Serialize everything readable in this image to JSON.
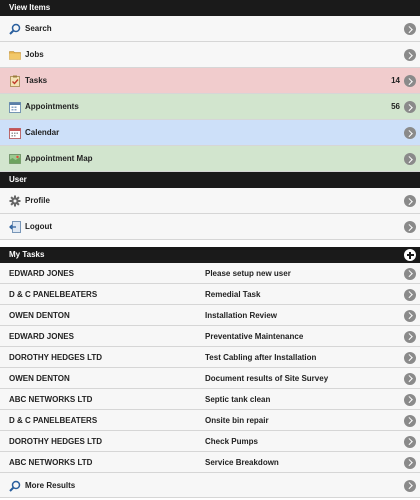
{
  "view_items": {
    "header": "View Items",
    "items": [
      {
        "label": "Search",
        "icon": "search-icon",
        "count": ""
      },
      {
        "label": "Jobs",
        "icon": "folder-icon",
        "count": ""
      },
      {
        "label": "Tasks",
        "icon": "tasks-icon",
        "count": "14"
      },
      {
        "label": "Appointments",
        "icon": "appointments-icon",
        "count": "56"
      },
      {
        "label": "Calendar",
        "icon": "calendar-icon",
        "count": ""
      },
      {
        "label": "Appointment Map",
        "icon": "map-icon",
        "count": ""
      }
    ]
  },
  "user": {
    "header": "User",
    "items": [
      {
        "label": "Profile",
        "icon": "gear-icon"
      },
      {
        "label": "Logout",
        "icon": "logout-icon"
      }
    ]
  },
  "my_tasks": {
    "header": "My Tasks",
    "rows": [
      {
        "client": "EDWARD JONES",
        "task": "Please setup new user"
      },
      {
        "client": "D & C PANELBEATERS",
        "task": "Remedial Task"
      },
      {
        "client": "OWEN DENTON",
        "task": "Installation Review"
      },
      {
        "client": "EDWARD JONES",
        "task": "Preventative Maintenance"
      },
      {
        "client": "DOROTHY HEDGES LTD",
        "task": "Test Cabling after Installation"
      },
      {
        "client": "OWEN DENTON",
        "task": "Document results of Site Survey"
      },
      {
        "client": "ABC NETWORKS LTD",
        "task": "Septic tank clean"
      },
      {
        "client": "D & C PANELBEATERS",
        "task": "Onsite bin repair"
      },
      {
        "client": "DOROTHY HEDGES LTD",
        "task": "Check Pumps"
      },
      {
        "client": "ABC NETWORKS LTD",
        "task": "Service Breakdown"
      }
    ],
    "more_label": "More Results"
  },
  "colors": {
    "header_bg": "#1a1a1a",
    "row_default": "#f7f7f7",
    "row_tasks": "#f1cccd",
    "row_appointments": "#d2e5ce",
    "row_calendar": "#cde0f9",
    "row_map": "#d2e5ce"
  }
}
